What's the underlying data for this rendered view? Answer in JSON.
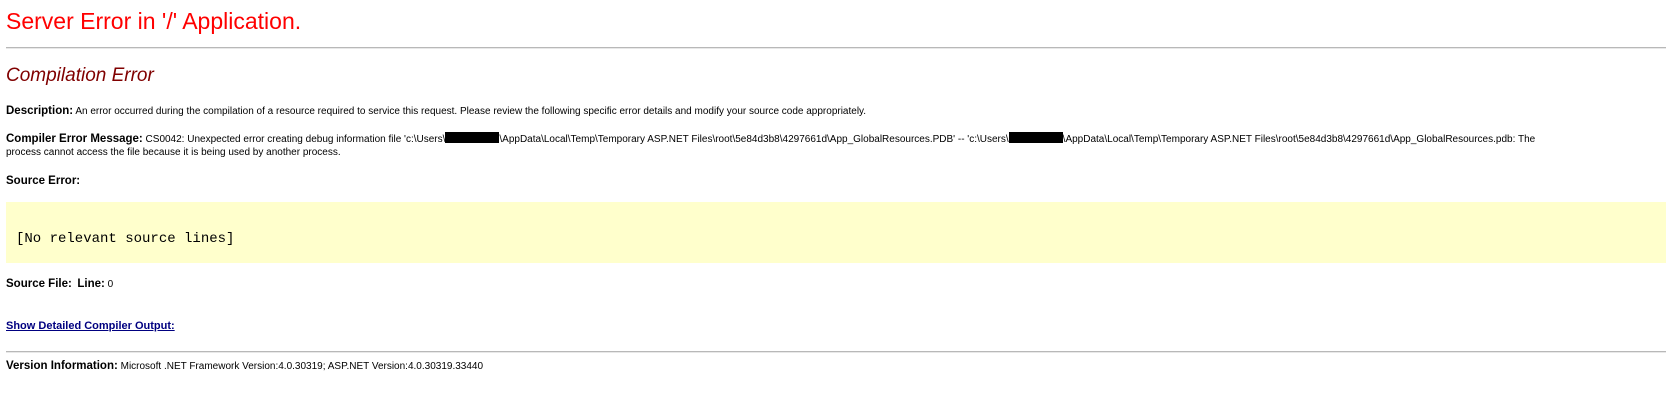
{
  "header": {
    "title": "Server Error in '/' Application."
  },
  "error": {
    "type": "Compilation Error",
    "description_label": "Description:",
    "description_text": "An error occurred during the compilation of a resource required to service this request. Please review the following specific error details and modify your source code appropriately.",
    "compiler_message_label": "Compiler Error Message:",
    "compiler_message_part1": "CS0042: Unexpected error creating debug information file 'c:\\Users\\",
    "compiler_message_part2": "\\AppData\\Local\\Temp\\Temporary ASP.NET Files\\root\\5e84d3b8\\4297661d\\App_GlobalResources.PDB' -- 'c:\\Users\\",
    "compiler_message_part3": "\\AppData\\Local\\Temp\\Temporary ASP.NET Files\\root\\5e84d3b8\\4297661d\\App_GlobalResources.pdb: The",
    "compiler_message_part4": "process cannot access the file because it is being used by another process.",
    "source_error_label": "Source Error:",
    "source_error_text": "[No relevant source lines]",
    "source_file_label": "Source File:",
    "source_file_value": "",
    "line_label": "Line:",
    "line_value": "0",
    "detailed_output_link": "Show Detailed Compiler Output:"
  },
  "version": {
    "label": "Version Information:",
    "text": "Microsoft .NET Framework Version:4.0.30319; ASP.NET Version:4.0.30319.33440"
  },
  "colors": {
    "title": "#ff0000",
    "subtitle": "#800000",
    "source_background": "#ffffcc",
    "link": "#000080"
  }
}
